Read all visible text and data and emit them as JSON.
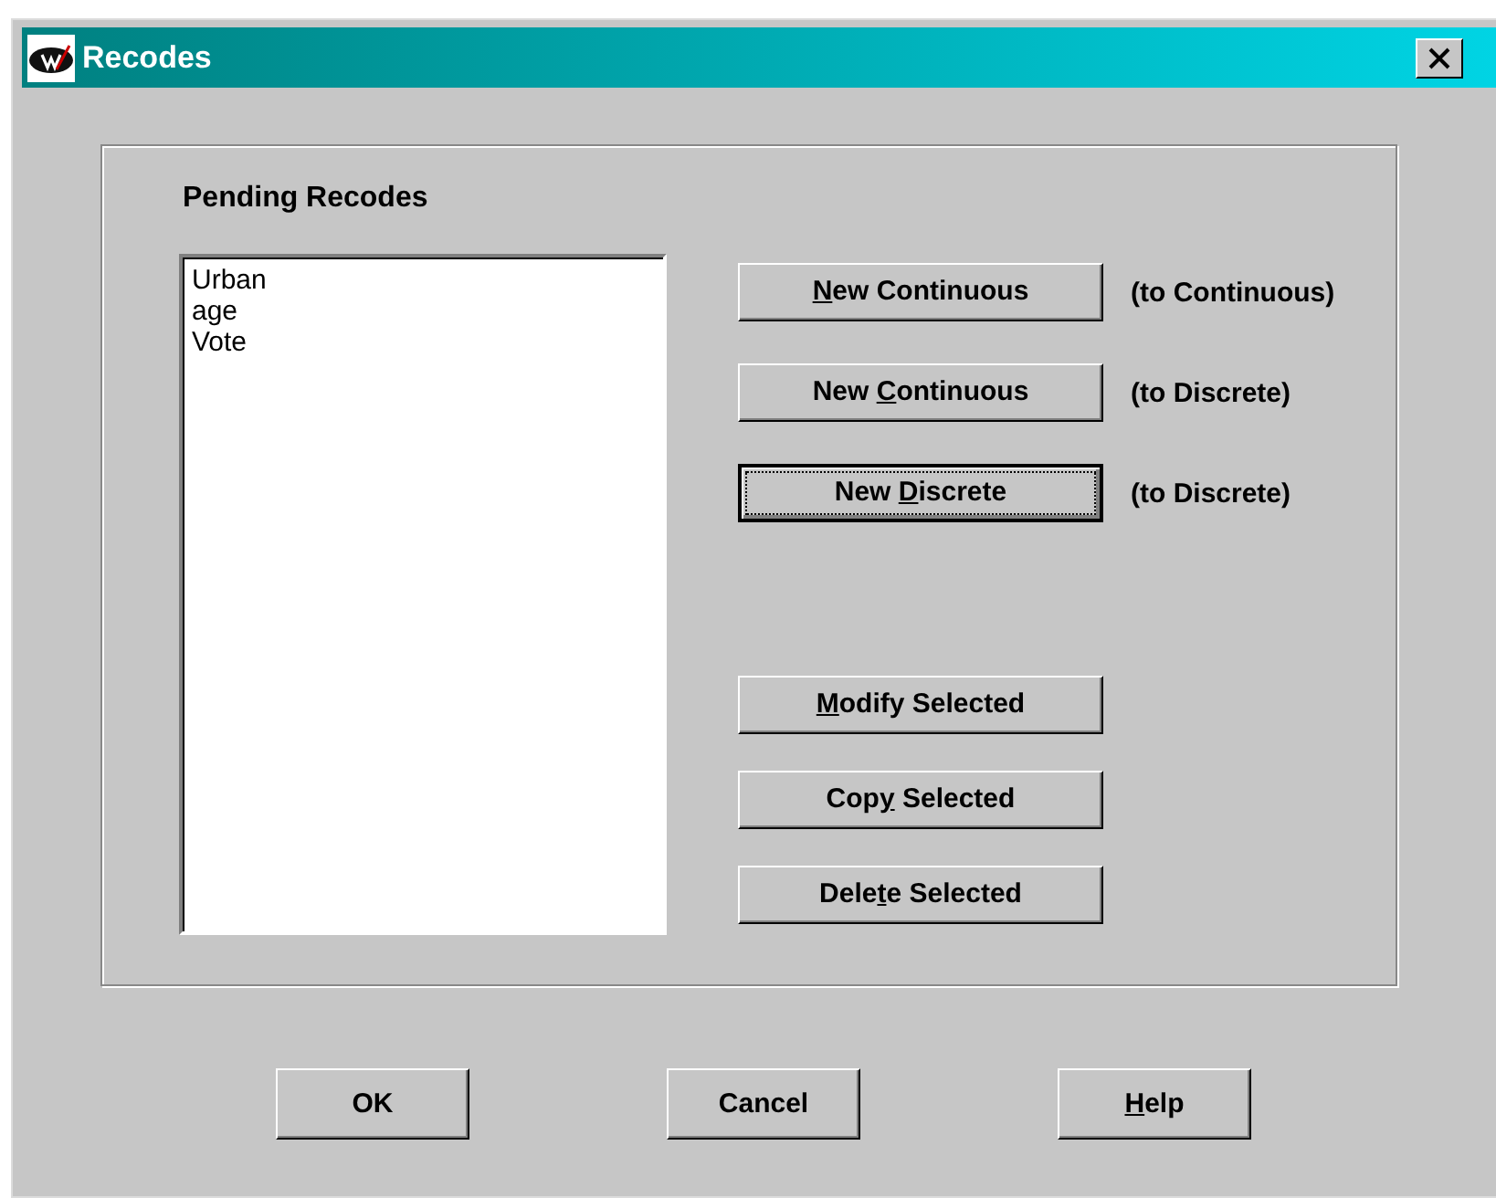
{
  "window": {
    "title": "Recodes"
  },
  "group": {
    "title": "Pending Recodes"
  },
  "list": {
    "items": [
      {
        "text": "Urban",
        "selected": false
      },
      {
        "text": "age",
        "selected": false
      },
      {
        "text": "Vote",
        "selected": false
      }
    ]
  },
  "new_buttons": [
    {
      "key": "N",
      "post": "ew Continuous",
      "focused": false,
      "note": "(to Continuous)"
    },
    {
      "pre": "New ",
      "key": "C",
      "post": "ontinuous",
      "focused": false,
      "note": "(to Discrete)"
    },
    {
      "pre": "New ",
      "key": "D",
      "post": "iscrete",
      "focused": true,
      "note": "(to Discrete)"
    }
  ],
  "action_buttons": [
    {
      "key": "M",
      "post": "odify Selected",
      "focused": false
    },
    {
      "pre": "Cop",
      "key": "y",
      "post": " Selected",
      "focused": false
    },
    {
      "pre": "Dele",
      "key": "t",
      "post": "e Selected",
      "focused": false
    }
  ],
  "dialog_buttons": [
    {
      "pre": "OK",
      "focused": false
    },
    {
      "pre": "Cancel",
      "focused": false
    },
    {
      "key": "H",
      "post": "elp",
      "focused": false
    }
  ]
}
